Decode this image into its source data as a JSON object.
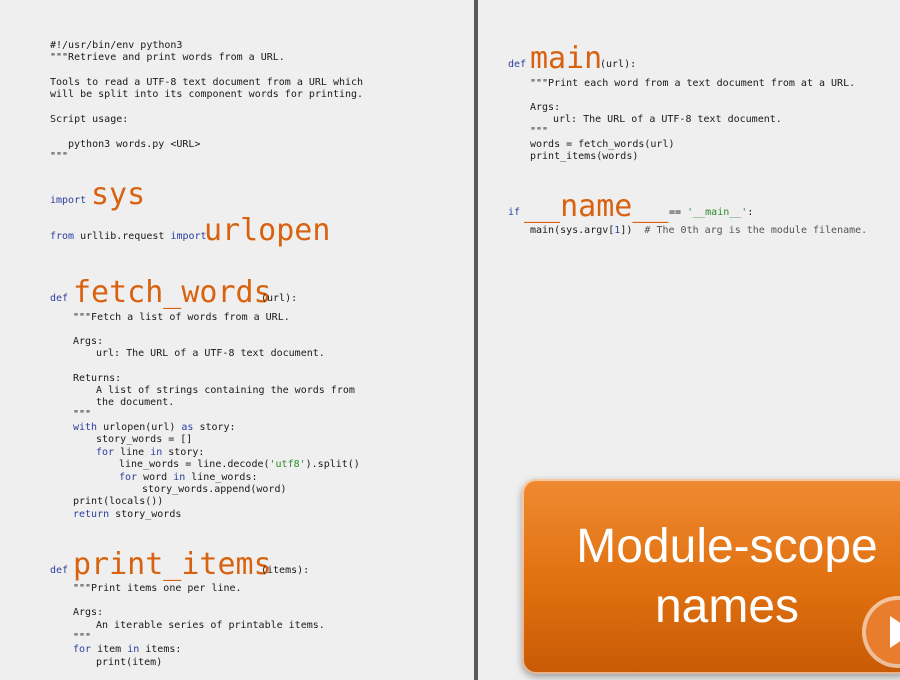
{
  "left": {
    "shebang": "#!/usr/bin/env python3",
    "doc_open": "\"\"\"Retrieve and print words from a URL.",
    "tools1": "Tools to read a UTF-8 text document from a URL which",
    "tools2": "will be split into its component words for printing.",
    "usage": "Script usage:",
    "usage_cmd": "python3 words.py <URL>",
    "doc_close": "\"\"\"",
    "kw_import": "import",
    "sys": "sys",
    "kw_from": "from",
    "module": "urllib.request",
    "urlopen": "urlopen",
    "kw_def": "def",
    "fetch_words": "fetch_words",
    "fetch_params": "(url):",
    "fw_doc": "\"\"\"Fetch a list of words from a URL.",
    "args": "Args:",
    "fw_arg": "url: The URL of a UTF-8 text document.",
    "returns": "Returns:",
    "fw_ret1": "A list of strings containing the words from",
    "fw_ret2": "the document.",
    "fw_doc_close": "\"\"\"",
    "kw_with": "with",
    "with_rest": " urlopen(url) ",
    "kw_as": "as",
    "with_tail": " story:",
    "story_words": "story_words = []",
    "kw_for": "for",
    "for1_mid": " line ",
    "kw_in": "in",
    "for1_tail": " story:",
    "line_words_a": "line_words = line.decode(",
    "utf8": "'utf8'",
    "line_words_b": ").split()",
    "for2_mid": " word ",
    "for2_tail": " line_words:",
    "append": "story_words.append(word)",
    "print_locals": "print(locals())",
    "kw_return": "return",
    "return_rest": " story_words",
    "print_items": "print_items",
    "pi_params": "(items):",
    "pi_doc": "\"\"\"Print items one per line.",
    "pi_arg": "An iterable series of printable items.",
    "pi_doc_close": "\"\"\"",
    "for3_mid": " item ",
    "for3_tail": " items:",
    "print_item": "print(item)"
  },
  "right": {
    "kw_def": "def",
    "main": "main",
    "main_params": "(url):",
    "main_doc": "\"\"\"Print each word from a text document from at a URL.",
    "args": "Args:",
    "main_arg": "url: The URL of a UTF-8 text document.",
    "main_doc_close": "\"\"\"",
    "words_line": "words = fetch_words(url)",
    "print_items_line": "print_items(words)",
    "kw_if": "if",
    "dunder_name": "__name__",
    "eq": " == ",
    "main_str": "'__main__'",
    "colon": ":",
    "call_a": "main(sys.argv[",
    "num1": "1",
    "call_b": "])  ",
    "comment": "# The 0th arg is the module filename."
  },
  "overlay": {
    "line1": "Module-scope",
    "line2": "names"
  },
  "icons": {
    "play": "play-icon"
  },
  "colors": {
    "highlight": "#d8620f",
    "keyword": "#2b3f9e",
    "string": "#2a8a2a",
    "overlay": "#e0700f"
  }
}
